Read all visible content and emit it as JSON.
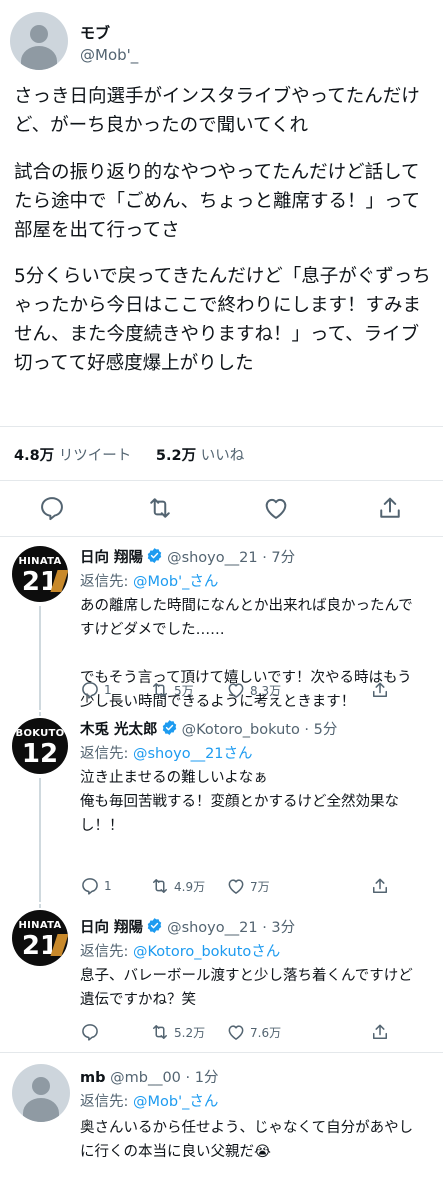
{
  "main_tweet": {
    "author_name": "モブ",
    "author_handle": "@Mob'_",
    "paragraph_1": "さっき日向選手がインスタライブやってたんだけ\nど、がーち良かったので聞いてくれ",
    "paragraph_2": "試合の振り返り的なやつやってたんだけど話して\nたら途中で「ごめん、ちょっと離席する！」って\n部屋を出て行ってさ",
    "paragraph_3": "5分くらいで戻ってきたんだけど「息子がぐずっち\nゃったから今日はここで終わりにします！すみま\nせん、また今度続きやりますね！」って、ライブ\n切ってて好感度爆上がりした",
    "retweet_count": "4.8万",
    "retweet_label": "リツイート",
    "like_count": "5.2万",
    "like_label": "いいね"
  },
  "replies": [
    {
      "avatar_name": "HINATA",
      "avatar_number": "21",
      "name": "日向 翔陽",
      "handle_time": "@shoyo__21 · 7分",
      "replyto_prefix": "返信先: ",
      "replyto_mention": "@Mob'_さん",
      "text": "あの離席した時間になんとか出来れば良かったんで\nすけどダメでした……\n\nでもそう言って頂けて嬉しいです！次やる時はもう\n少し長い時間できるように考えときます！",
      "reply_count": "1",
      "retweet_count": "5万",
      "like_count": "8.3万"
    },
    {
      "avatar_name": "BOKUTO",
      "avatar_number": "12",
      "name": "木兎 光太郎",
      "handle_time": "@Kotoro_bokuto · 5分",
      "replyto_prefix": "返信先: ",
      "replyto_mention": "@shoyo__21さん",
      "text": "泣き止ませるの難しいよなぁ\n俺も毎回苦戦する！変顔とかするけど全然効果な\nし！！",
      "reply_count": "1",
      "retweet_count": "4.9万",
      "like_count": "7万"
    },
    {
      "avatar_name": "HINATA",
      "avatar_number": "21",
      "name": "日向 翔陽",
      "handle_time": "@shoyo__21 · 3分",
      "replyto_prefix": "返信先: ",
      "replyto_mention": "@Kotoro_bokutoさん",
      "text": "息子、バレーボール渡すと少し落ち着くんですけど\n遺伝ですかね？笑",
      "retweet_count": "5.2万",
      "like_count": "7.6万"
    },
    {
      "name": "mb",
      "handle_time": "@mb__00 · 1分",
      "replyto_prefix": "返信先: ",
      "replyto_mention": "@Mob'_さん",
      "text": "奥さんいるから任せよう、じゃなくて自分があやし\nに行くの本当に良い父親だ😭"
    }
  ],
  "colors": {
    "text": "#0f1419",
    "secondary": "#536471",
    "link": "#1d9bf0",
    "verified": "#1d9bf0",
    "divider": "#e4e8eb"
  },
  "icons": [
    "reply-icon",
    "retweet-icon",
    "like-icon",
    "share-icon",
    "verified-badge-icon"
  ]
}
